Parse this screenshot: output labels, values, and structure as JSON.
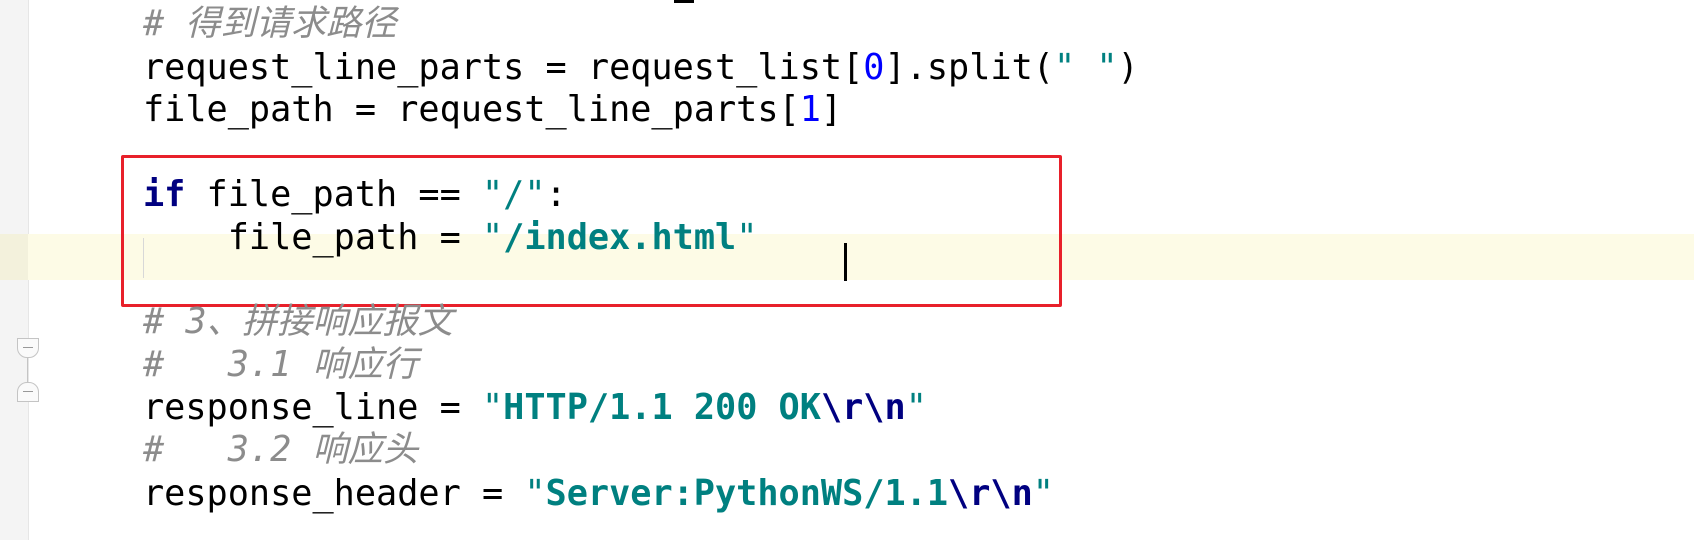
{
  "editor": {
    "lines": {
      "comment_path": "# 得到请求路径",
      "req_line_var": "request_line_parts",
      "req_line_mid": " = request_list[",
      "req_line_idx": "0",
      "req_line_mid2": "].split(",
      "req_line_str": "\" \"",
      "req_line_end": ")",
      "file_path_assign": "file_path = request_line_parts[",
      "file_path_idx": "1",
      "file_path_end": "]",
      "if_kw": "if",
      "if_mid": " file_path == ",
      "if_str": "\"/\"",
      "if_end": ":",
      "assign_indent": "    file_path = ",
      "assign_str_open": "\"",
      "assign_str": "/index.html",
      "assign_str_close": "\"",
      "comment_concat": "# 3、拼接响应报文",
      "comment_resp_line": "#   3.1 响应行",
      "response_line_var": "response_line = ",
      "response_line_q1": "\"",
      "response_line_str": "HTTP/1.1 200 OK",
      "response_line_esc": "\\r\\n",
      "response_line_q2": "\"",
      "comment_resp_header": "#   3.2 响应头",
      "response_header_var": "response_header = ",
      "response_header_q1": "\"",
      "response_header_str": "Server:PythonWS/1.1",
      "response_header_esc": "\\r\\n",
      "response_header_q2": "\""
    }
  }
}
